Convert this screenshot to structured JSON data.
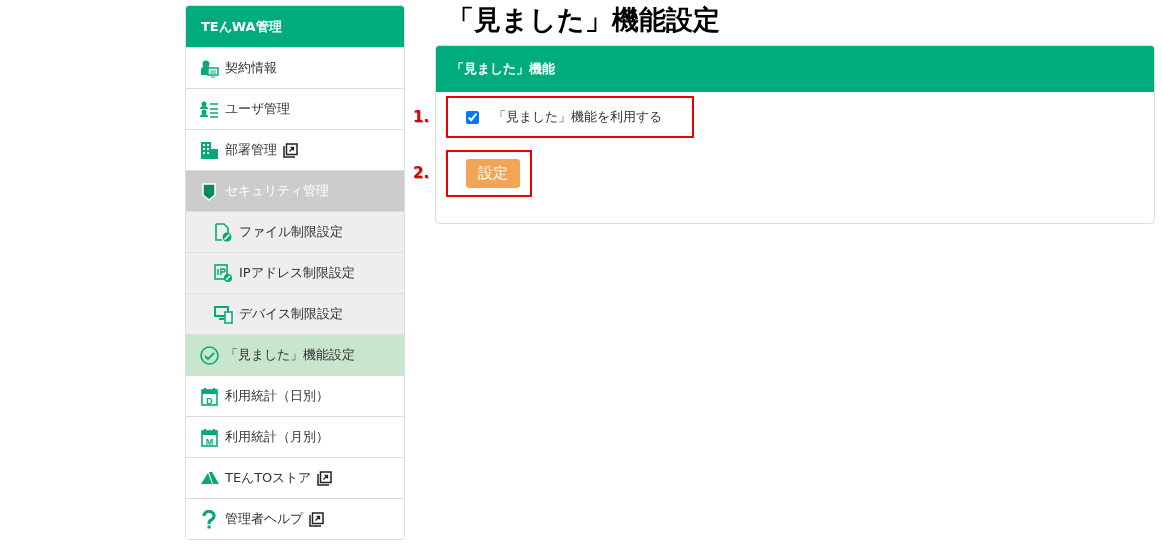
{
  "sidebar": {
    "title": "TEんWA管理",
    "items": [
      {
        "label": "契約情報",
        "kind": "contract",
        "external": false,
        "selected": false
      },
      {
        "label": "ユーザ管理",
        "kind": "users",
        "external": false,
        "selected": false
      },
      {
        "label": "部署管理",
        "kind": "building",
        "external": true,
        "selected": false
      },
      {
        "label": "セキュリティ管理",
        "kind": "shield",
        "external": false,
        "selected": false,
        "expanded": true,
        "children": [
          {
            "label": "ファイル制限設定",
            "kind": "file",
            "external": false,
            "selected": false
          },
          {
            "label": "IPアドレス制限設定",
            "kind": "ip",
            "external": false,
            "selected": false
          },
          {
            "label": "デバイス制限設定",
            "kind": "device",
            "external": false,
            "selected": false
          }
        ]
      },
      {
        "label": "「見ました」機能設定",
        "kind": "check",
        "external": false,
        "selected": true
      },
      {
        "label": "利用統計（日別）",
        "kind": "calendar",
        "badge": "D",
        "external": false,
        "selected": false
      },
      {
        "label": "利用統計（月別）",
        "kind": "calendar",
        "badge": "M",
        "external": false,
        "selected": false
      },
      {
        "label": "TEんTOストア",
        "kind": "store",
        "external": true,
        "selected": false
      },
      {
        "label": "管理者ヘルプ",
        "kind": "help",
        "external": true,
        "selected": false
      }
    ]
  },
  "page_title": "「見ました」機能設定",
  "panel": {
    "title": "「見ました」機能",
    "option": {
      "label": "「見ました」機能を利用する",
      "checked": true,
      "callout": "1."
    },
    "button": {
      "label": "設定",
      "callout": "2."
    }
  }
}
